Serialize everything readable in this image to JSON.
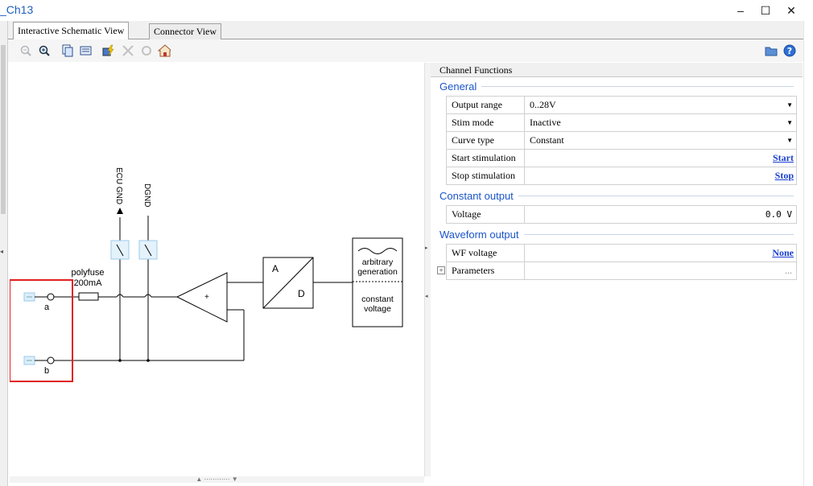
{
  "window": {
    "title": "_Ch13",
    "controls": {
      "minimize": "–",
      "maximize": "☐",
      "close": "✕"
    }
  },
  "tabs": [
    {
      "label": "Interactive Schematic View",
      "active": true
    },
    {
      "label": "Connector View",
      "active": false
    }
  ],
  "toolbar": {
    "icons": [
      "zoom-out-icon",
      "zoom-in-icon",
      "copy-icon",
      "properties-icon",
      "flash-icon",
      "disconnect-icon",
      "reset-icon",
      "home-icon",
      "folder-icon",
      "help-icon"
    ]
  },
  "schematic": {
    "labels": {
      "ecu_gnd": "ECU GND",
      "dgnd": "DGND",
      "polyfuse": "polyfuse",
      "polyfuse_rating": "200mA",
      "pin_a": "a",
      "pin_b": "b",
      "amp_plus": "+",
      "adc_a": "A",
      "adc_d": "D",
      "arbitrary": "arbitrary",
      "generation": "generation",
      "constant": "constant",
      "voltage": "voltage"
    },
    "highlight_color": "#e02020"
  },
  "panel": {
    "header": "Channel Functions",
    "sections": {
      "general": "General",
      "constant_output": "Constant output",
      "waveform_output": "Waveform output"
    },
    "general_rows": [
      {
        "name": "Output range",
        "value": "0..28V",
        "dropdown": true
      },
      {
        "name": "Stim mode",
        "value": "Inactive",
        "dropdown": true
      },
      {
        "name": "Curve type",
        "value": "Constant",
        "dropdown": true
      },
      {
        "name": "Start stimulation",
        "link": "Start"
      },
      {
        "name": "Stop stimulation",
        "link": "Stop"
      }
    ],
    "constant_rows": [
      {
        "name": "Voltage",
        "value": "0.0 V"
      }
    ],
    "waveform_rows": [
      {
        "name": "WF voltage",
        "link": "None"
      },
      {
        "name": "Parameters",
        "value": "...",
        "expander": "+"
      }
    ],
    "accent_color": "#1a55c8",
    "link_color": "#1a3fd0"
  }
}
